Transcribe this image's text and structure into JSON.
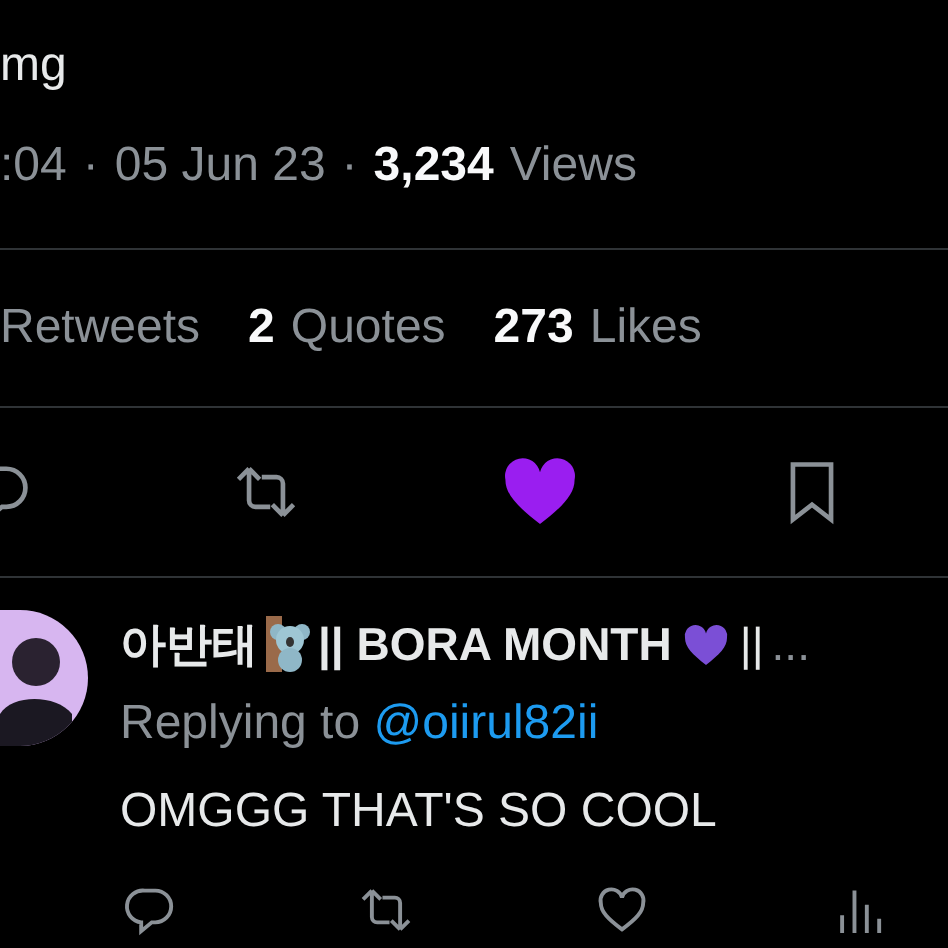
{
  "tweet": {
    "text_tail": "mg",
    "time": ":04",
    "separator": "·",
    "date": "05 Jun 23",
    "views_count": "3,234",
    "views_label": "Views",
    "stats": [
      {
        "label": "Retweets"
      },
      {
        "count": "2",
        "label": "Quotes"
      },
      {
        "count": "273",
        "label": "Likes"
      }
    ],
    "actions": [
      {
        "kind": "reply"
      },
      {
        "kind": "retweet"
      },
      {
        "kind": "like",
        "liked": true
      },
      {
        "kind": "bookmark"
      }
    ]
  },
  "reply": {
    "name_parts": [
      "아반태",
      "|| BORA MONTH",
      "||",
      "..."
    ],
    "replying_label": "Replying to",
    "replying_handle": "@oiirul82ii",
    "text": "OMGGG THAT'S SO COOL",
    "actions": [
      {
        "kind": "reply"
      },
      {
        "kind": "retweet"
      },
      {
        "kind": "like"
      },
      {
        "kind": "views"
      }
    ]
  }
}
